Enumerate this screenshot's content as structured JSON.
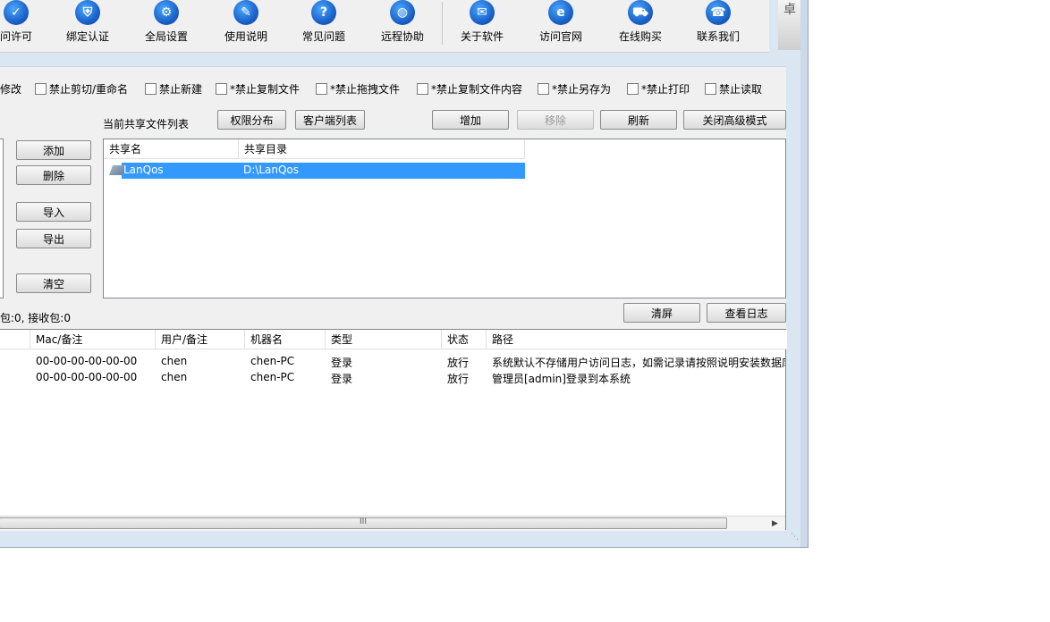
{
  "toolbar": {
    "items": [
      {
        "label": "问许可",
        "icon": "key-icon",
        "glyph": "✓"
      },
      {
        "label": "绑定认证",
        "icon": "shield-icon",
        "glyph": "⛨"
      },
      {
        "label": "全局设置",
        "icon": "gear-icon",
        "glyph": "⚙"
      },
      {
        "label": "使用说明",
        "icon": "graduation-cap-icon",
        "glyph": "✎"
      },
      {
        "label": "常见问题",
        "icon": "question-icon",
        "glyph": "?"
      },
      {
        "label": "远程协助",
        "icon": "globe-icon",
        "glyph": "◍"
      },
      {
        "label": "关于软件",
        "icon": "document-icon",
        "glyph": "✉"
      },
      {
        "label": "访问官网",
        "icon": "ie-icon",
        "glyph": "e"
      },
      {
        "label": "在线购买",
        "icon": "cart-icon",
        "glyph": "⛟"
      },
      {
        "label": "联系我们",
        "icon": "phone-icon",
        "glyph": "☎"
      }
    ]
  },
  "restrictions": {
    "items": [
      "修改",
      "禁止剪切/重命名",
      "禁止新建",
      "*禁止复制文件",
      "*禁止拖拽文件",
      "*禁止复制文件内容",
      "*禁止另存为",
      "*禁止打印",
      "禁止读取"
    ]
  },
  "shares": {
    "title": "当前共享文件列表",
    "perm_button": "权限分布",
    "clients_button": "客户端列表",
    "add_button": "增加",
    "remove_button": "移除",
    "refresh_button": "刷新",
    "advanced_button": "关闭高级模式",
    "columns": [
      "共享名",
      "共享目录"
    ],
    "rows": [
      {
        "name": "LanQos",
        "path": "D:\\LanQos"
      }
    ]
  },
  "left_buttons": {
    "add": "添加",
    "delete": "删除",
    "import": "导入",
    "export": "导出",
    "clear": "清空"
  },
  "log": {
    "packet_status": "包:0, 接收包:0",
    "clear_button": "清屏",
    "view_button": "查看日志",
    "columns": [
      "Mac/备注",
      "用户/备注",
      "机器名",
      "类型",
      "状态",
      "路径"
    ],
    "rows": [
      {
        "mac": "00-00-00-00-00-00",
        "user": "chen",
        "machine": "chen-PC",
        "type": "登录",
        "status": "放行",
        "path": "系统默认不存储用户访问日志，如需记录请按照说明安装数据库"
      },
      {
        "mac": "00-00-00-00-00-00",
        "user": "chen",
        "machine": "chen-PC",
        "type": "登录",
        "status": "放行",
        "path": "管理员[admin]登录到本系统"
      }
    ],
    "scroll_grip": "III"
  },
  "logo": {
    "glyph": "卓"
  }
}
